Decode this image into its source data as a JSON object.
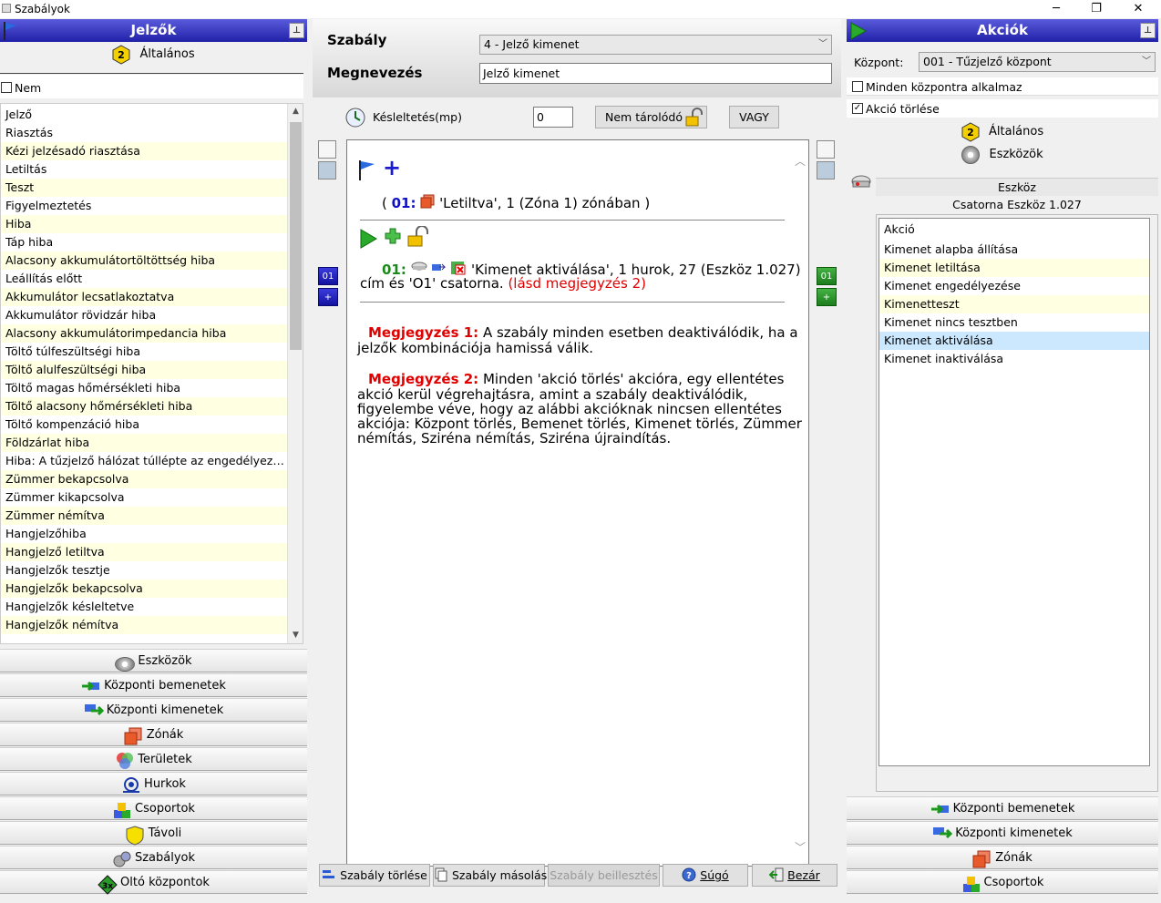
{
  "window": {
    "title": "Szabályok"
  },
  "left": {
    "header": "Jelzők",
    "general_tab": "Általános",
    "nem_label": "Nem",
    "list_header": "Jelző",
    "items": [
      "Riasztás",
      "Kézi jelzésadó riasztása",
      "Letiltás",
      "Teszt",
      "Figyelmeztetés",
      "Hiba",
      "Táp hiba",
      "Alacsony akkumulátortöltöttség hiba",
      "Leállítás előtt",
      "Akkumulátor lecsatlakoztatva",
      "Akkumulátor rövidzár hiba",
      "Alacsony akkumulátorimpedancia hiba",
      "Töltő túlfeszültségi hiba",
      "Töltő alulfeszültségi hiba",
      "Töltő magas hőmérsékleti hiba",
      "Töltő alacsony hőmérsékleti hiba",
      "Töltő kompenzáció hiba",
      "Földzárlat hiba",
      "Hiba: A tűzjelző hálózat túllépte az engedélyezett kapacitást",
      "Zümmer bekapcsolva",
      "Zümmer kikapcsolva",
      "Zümmer némítva",
      "Hangjelzőhiba",
      "Hangjelző letiltva",
      "Hangjelzők tesztje",
      "Hangjelzők bekapcsolva",
      "Hangjelzők késleltetve",
      "Hangjelzők némítva"
    ],
    "nav": [
      "Eszközök",
      "Központi bemenetek",
      "Központi kimenetek",
      "Zónák",
      "Területek",
      "Hurkok",
      "Csoportok",
      "Távoli",
      "Szabályok",
      "Oltó központok"
    ]
  },
  "center": {
    "rule_label": "Szabály",
    "rule_value": "4 - Jelző kimenet",
    "name_label": "Megnevezés",
    "name_value": "Jelző kimenet",
    "delay_label": "Késleltetés(mp)",
    "delay_value": "0",
    "nonstore_button": "Nem tárolódó",
    "or_button": "VAGY",
    "cond_prefix": "( ",
    "cond_num": "01:",
    "cond_text": "'Letiltva', 1 (Zóna 1) zónában )",
    "action_num": "01:",
    "action_text": "'Kimenet aktiválása', 1 hurok, 27 (Eszköz 1.027)",
    "action_text2": "cím és 'O1' csatorna.",
    "action_note_ref": "(lásd megjegyzés 2)",
    "note1_label": "Megjegyzés 1:",
    "note1_text_a": "A szabály minden esetben deaktiválódik, ha a",
    "note1_text_b": "jelzők kombinációja hamissá válik.",
    "note2_label": "Megjegyzés 2:",
    "note2_lines": [
      "Minden 'akció törlés' akcióra, egy ellentétes",
      "akció kerül végrehajtásra, amint a szabály deaktiválódik,",
      "figyelembe véve, hogy az alábbi akcióknak nincsen ellentétes",
      "akciója: Központ törlés, Bemenet törlés, Kimenet törlés, Zümmer",
      "némítás, Sziréna némítás, Sziréna újraindítás."
    ],
    "left_badge": "01",
    "left_plus": "+",
    "right_badge": "01",
    "right_plus": "+",
    "footer": {
      "delete": "Szabály törlése",
      "copy": "Szabály másolás",
      "paste": "Szabály beillesztés",
      "help": "Súgó",
      "close": "Bezár"
    }
  },
  "right": {
    "header": "Akciók",
    "central_label": "Központ:",
    "central_value": "001 - Tűzjelző központ",
    "apply_all": "Minden központra alkalmaz",
    "action_delete": "Akció törlése",
    "general_tab": "Általános",
    "devices_tab": "Eszközök",
    "device_header": "Eszköz",
    "device_name": "Csatorna Eszköz 1.027",
    "list_header": "Akció",
    "items": [
      "Kimenet alapba állítása",
      "Kimenet letiltása",
      "Kimenet engedélyezése",
      "Kimenetteszt",
      "Kimenet nincs tesztben",
      "Kimenet aktiválása",
      "Kimenet inaktiválása"
    ],
    "nav": [
      "Központi bemenetek",
      "Központi kimenetek",
      "Zónák",
      "Csoportok"
    ]
  },
  "colors": {
    "header_blue": "#2121a8",
    "alt_row": "#ffffe1",
    "selected_row": "#cce8ff",
    "note_red": "#e00000"
  }
}
